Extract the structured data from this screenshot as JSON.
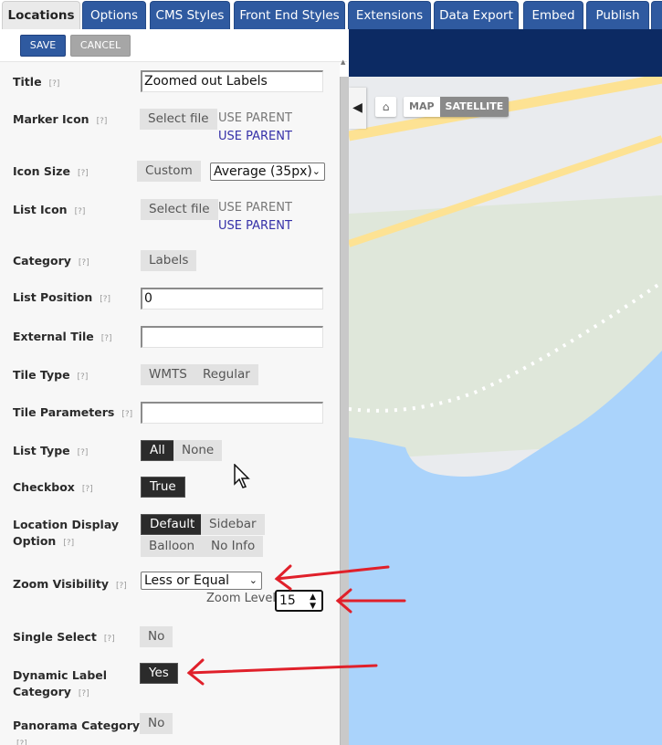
{
  "tabs": [
    {
      "label": "Locations",
      "active": true
    },
    {
      "label": "Options",
      "active": false
    },
    {
      "label": "CMS Styles",
      "active": false
    },
    {
      "label": "Front End Styles",
      "active": false
    },
    {
      "label": "Extensions",
      "active": false
    },
    {
      "label": "Data Export",
      "active": false
    },
    {
      "label": "Embed",
      "active": false
    },
    {
      "label": "Publish",
      "active": false
    }
  ],
  "toolbar": {
    "save_label": "SAVE",
    "cancel_label": "CANCEL"
  },
  "help_marker": "[?]",
  "form": {
    "title": {
      "label": "Title",
      "value": "Zoomed out Labels"
    },
    "marker_icon": {
      "label": "Marker Icon",
      "button": "Select file",
      "status": "USE PARENT",
      "link": "USE PARENT"
    },
    "icon_size": {
      "label": "Icon Size",
      "button": "Custom",
      "selected": "Average (35px)"
    },
    "list_icon": {
      "label": "List Icon",
      "button": "Select file",
      "status": "USE PARENT",
      "link": "USE PARENT"
    },
    "category": {
      "label": "Category",
      "value": "Labels"
    },
    "list_position": {
      "label": "List Position",
      "value": "0"
    },
    "external_tile": {
      "label": "External Tile",
      "value": ""
    },
    "tile_type": {
      "label": "Tile Type",
      "options": [
        "WMTS",
        "Regular"
      ]
    },
    "tile_parameters": {
      "label": "Tile Parameters",
      "value": ""
    },
    "list_type": {
      "label": "List Type",
      "options": [
        "All",
        "None"
      ],
      "selected": "All"
    },
    "checkbox": {
      "label": "Checkbox",
      "value": "True"
    },
    "location_display_option": {
      "label_line1": "Location Display",
      "label_line2": "Option",
      "options": [
        "Default",
        "Sidebar",
        "Balloon",
        "No Info"
      ],
      "selected": "Default"
    },
    "zoom_visibility": {
      "label": "Zoom Visibility",
      "selected": "Less or Equal",
      "zoom_level_label": "Zoom Level",
      "zoom_level_value": "15"
    },
    "single_select": {
      "label": "Single Select",
      "value": "No"
    },
    "dynamic_label_category": {
      "label_line1": "Dynamic Label",
      "label_line2": "Category",
      "value": "Yes"
    },
    "panorama_category": {
      "label": "Panorama Category",
      "value": "No"
    }
  },
  "map": {
    "type_options": [
      "MAP",
      "SATELLITE"
    ],
    "selected_type": "SATELLITE",
    "colors": {
      "header": "#0c2a63",
      "land": "#dfe7da",
      "water": "#aad3fb",
      "road": "#fde293"
    }
  },
  "annotations": {
    "arrow_color": "#e0202a",
    "arrow_count": 3
  }
}
